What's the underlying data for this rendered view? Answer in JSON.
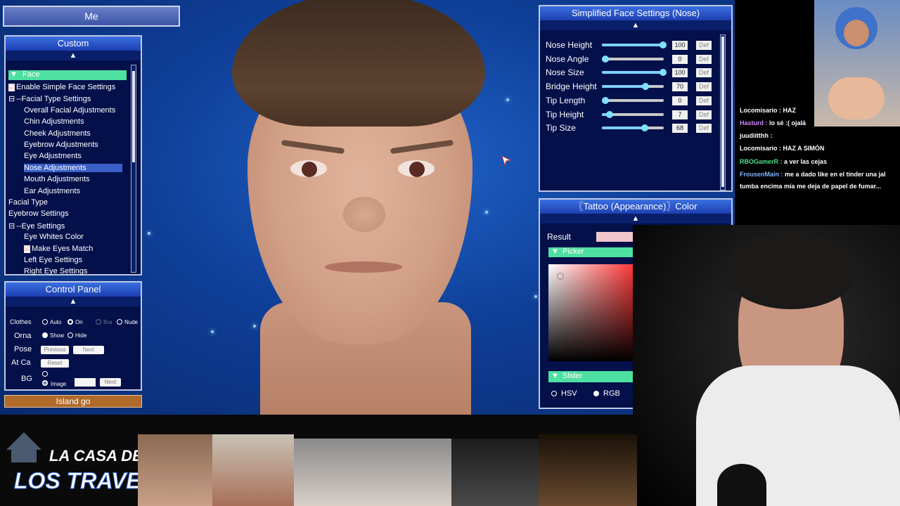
{
  "top_tab": {
    "label": "Me"
  },
  "custom_panel": {
    "title": "Custom",
    "selected": "Face",
    "items": [
      {
        "label": "Enable Simple Face Settings",
        "checked": true
      },
      {
        "label": "--Facial Type Settings",
        "collapse": "−"
      },
      {
        "label": "Overall Facial Adjustments"
      },
      {
        "label": "Chin Adjustments"
      },
      {
        "label": "Cheek Adjustments"
      },
      {
        "label": "Eyebrow Adjustments"
      },
      {
        "label": "Eye Adjustments"
      },
      {
        "label": "Nose Adjustments",
        "highlighted": true
      },
      {
        "label": "Mouth Adjustments"
      },
      {
        "label": "Ear Adjustments"
      },
      {
        "label": "Facial Type"
      },
      {
        "label": "Eyebrow Settings"
      },
      {
        "label": "--Eye Settings",
        "collapse": "−"
      },
      {
        "label": "Eye Whites Color"
      },
      {
        "label": "Make Eyes Match",
        "checked": true
      },
      {
        "label": "Left Eye Settings"
      },
      {
        "label": "Right Eye Settings"
      }
    ]
  },
  "control_panel": {
    "title": "Control Panel",
    "clothes_label": "Clothes",
    "clothes_options": [
      "Auto",
      "On",
      "Bra",
      "Nude"
    ],
    "orna_label": "Orna",
    "orna_options": [
      "Show",
      "Hide"
    ],
    "pose_label": "Pose",
    "pose_prev": "Previous",
    "pose_next": "Next",
    "atca_label": "At Ca",
    "atca_reset": "Reset",
    "bg_label": "BG",
    "bg_image": "Image",
    "bg_next": "Next",
    "island_button": "Island go"
  },
  "nose_panel": {
    "title": "Simplified Face Settings (Nose)",
    "def_label": "Def",
    "sliders": [
      {
        "label": "Nose Height",
        "value": "100",
        "fraction": 1.0
      },
      {
        "label": "Nose Angle",
        "value": "0",
        "fraction": 0.0
      },
      {
        "label": "Nose Size",
        "value": "100",
        "fraction": 1.0
      },
      {
        "label": "Bridge Height",
        "value": "70",
        "fraction": 0.7
      },
      {
        "label": "Tip Length",
        "value": "0",
        "fraction": 0.0
      },
      {
        "label": "Tip Height",
        "value": "7",
        "fraction": 0.07
      },
      {
        "label": "Tip Size",
        "value": "68",
        "fraction": 0.68
      }
    ]
  },
  "tattoo_panel": {
    "title": "〖Tattoo (Appearance)〗Color",
    "result_label": "Result",
    "result_color": "#f2c6cf",
    "picker_label": "Picker",
    "slider_label": "Slider",
    "mode_hsv": "HSV",
    "mode_rgb": "RGB",
    "selected_mode": "RGB"
  },
  "chat": [
    {
      "user": "Locomisario",
      "user_color": "#ffffff",
      "text": "HAZ"
    },
    {
      "user": "Hasturd",
      "user_color": "#d08bff",
      "text": "lo sé :( ojalá"
    },
    {
      "user": "juudiitthh",
      "user_color": "#ffffff",
      "text": ""
    },
    {
      "user": "Locomisario",
      "user_color": "#ffffff",
      "text": "HAZ A SIMÓN"
    },
    {
      "user": "RBOGamerR",
      "user_color": "#4fe08a",
      "text": "a ver las cejas"
    },
    {
      "user": "FrousenMain",
      "user_color": "#7fb6ff",
      "text": "me a dado like en el tinder una jal"
    },
    {
      "user": "",
      "user_color": "#ffffff",
      "text": "tumba encima mía me deja de papel de fumar..."
    }
  ],
  "overlay": {
    "logo_line1": "LA CASA DE",
    "logo_line2": "LOS TRAVELOS"
  }
}
